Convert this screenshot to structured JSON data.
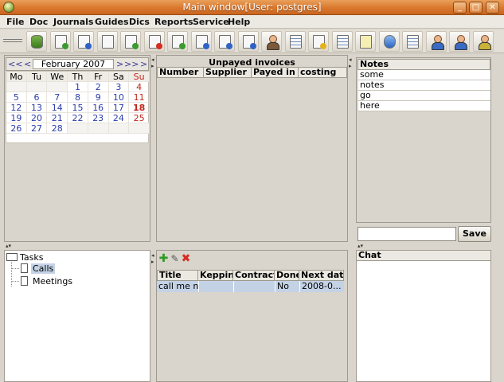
{
  "window": {
    "title": "Main window[User: postgres]"
  },
  "menu": [
    "File",
    "Doc",
    "Journals",
    "Guides",
    "Dics",
    "Reports",
    "Service",
    "Help"
  ],
  "toolbar": {
    "buttons": [
      {
        "name": "database-icon",
        "kind": "db"
      },
      {
        "name": "doc-add-icon",
        "kind": "docg"
      },
      {
        "name": "doc-import-icon",
        "kind": "docb"
      },
      {
        "name": "doc-search-icon",
        "kind": ""
      },
      {
        "name": "doc-refresh-icon",
        "kind": "docg"
      },
      {
        "name": "doc-delete-icon",
        "kind": "docr"
      },
      {
        "name": "doc-edit-icon",
        "kind": "docg"
      },
      {
        "name": "doc-export-icon",
        "kind": "docb"
      },
      {
        "name": "doc-upload-icon",
        "kind": "docb"
      },
      {
        "name": "doc-download-icon",
        "kind": "docb"
      },
      {
        "name": "users-icon",
        "kind": "person"
      },
      {
        "name": "list-icon",
        "kind": "list"
      },
      {
        "name": "report-icon",
        "kind": "docy"
      },
      {
        "name": "ledger-icon",
        "kind": "list"
      },
      {
        "name": "note-icon",
        "kind": "note"
      },
      {
        "name": "storage-icon",
        "kind": "blue"
      },
      {
        "name": "catalog-icon",
        "kind": "list"
      },
      {
        "name": "person-icon",
        "kind": "person"
      },
      {
        "name": "person-blue-icon",
        "kind": "person"
      },
      {
        "name": "person-green-icon",
        "kind": "person"
      }
    ]
  },
  "calendar": {
    "prev_year": "<<",
    "prev_month": "<",
    "month_label": "February 2007",
    "next_month": ">",
    "next_year": ">>",
    "extra_nav": ">",
    "weekdays": [
      "Mo",
      "Tu",
      "We",
      "Th",
      "Fr",
      "Sa",
      "Su"
    ],
    "weeks": [
      [
        "",
        "",
        "",
        "1",
        "2",
        "3",
        "4"
      ],
      [
        "5",
        "6",
        "7",
        "8",
        "9",
        "10",
        "11"
      ],
      [
        "12",
        "13",
        "14",
        "15",
        "16",
        "17",
        "18"
      ],
      [
        "19",
        "20",
        "21",
        "22",
        "23",
        "24",
        "25"
      ],
      [
        "26",
        "27",
        "28",
        "",
        "",
        "",
        ""
      ]
    ],
    "today": "18"
  },
  "unpaid_invoices": {
    "title": "Unpayed invoices",
    "columns": [
      "Number",
      "Supplier",
      "Payed in su",
      "costing"
    ]
  },
  "notes": {
    "header": "Notes",
    "items": [
      "some",
      "notes",
      "go",
      "here"
    ],
    "input_value": "",
    "save_label": "Save"
  },
  "tree": {
    "root": "Tasks",
    "children": [
      "Calls",
      "Meetings"
    ]
  },
  "tasks_table": {
    "columns": [
      "Title",
      "Kepping",
      "Contractor",
      "Done",
      "Next date:"
    ],
    "rows": [
      [
        "call me no",
        "",
        "",
        "No",
        "2008-0..."
      ]
    ]
  },
  "chat": {
    "header": "Chat"
  },
  "colors": {
    "titlebar": "#d9782e",
    "window_bg": "#d9d5cc",
    "selection": "#c4d2e6",
    "weekend": "#c0241a",
    "date_blue": "#2a3dab"
  }
}
